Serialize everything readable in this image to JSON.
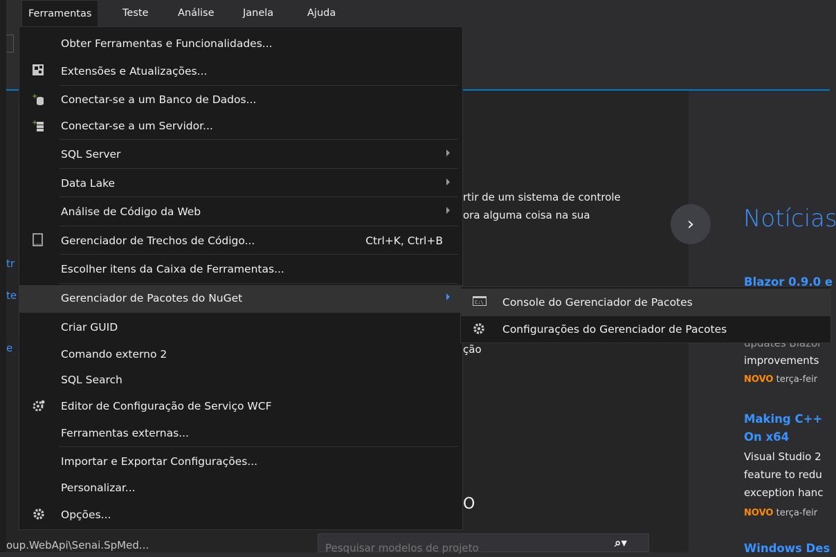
{
  "menubar": {
    "items": [
      "Ferramentas",
      "Teste",
      "Análise",
      "Janela",
      "Ajuda"
    ]
  },
  "tools_menu": {
    "items": [
      {
        "label": "Obter Ferramentas e Funcionalidades...",
        "icon": "none"
      },
      {
        "label": "Extensões e Atualizações...",
        "icon": "extensions-icon"
      },
      {
        "label": "Conectar-se a um Banco de Dados...",
        "icon": "database-connect-icon"
      },
      {
        "label": "Conectar-se a um Servidor...",
        "icon": "server-connect-icon"
      },
      {
        "label": "SQL Server",
        "submenu": true
      },
      {
        "label": "Data Lake",
        "submenu": true
      },
      {
        "label": "Análise de Código da Web",
        "submenu": true
      },
      {
        "label": "Gerenciador de Trechos de Código...",
        "shortcut": "Ctrl+K, Ctrl+B",
        "icon": "snippet-icon"
      },
      {
        "label": "Escolher itens da Caixa de Ferramentas..."
      },
      {
        "label": "Gerenciador de Pacotes do NuGet",
        "submenu": true,
        "highlighted": true
      },
      {
        "label": "Criar GUID"
      },
      {
        "label": "Comando externo 2"
      },
      {
        "label": "SQL Search"
      },
      {
        "label": "Editor de Configuração de Serviço WCF",
        "icon": "wcf-config-icon"
      },
      {
        "label": "Ferramentas externas..."
      },
      {
        "label": "Importar e Exportar Configurações..."
      },
      {
        "label": "Personalizar..."
      },
      {
        "label": "Opções...",
        "icon": "gear-icon"
      }
    ]
  },
  "nuget_submenu": {
    "items": [
      {
        "label": "Console do Gerenciador de Pacotes",
        "icon": "console-icon",
        "highlighted": true
      },
      {
        "label": "Configurações do Gerenciador de Pacotes",
        "icon": "gear-icon"
      }
    ]
  },
  "start_page": {
    "partial_line1": "rtir de um sistema de controle",
    "partial_line2": "ora alguma coisa na sua",
    "partial_line3": "ção",
    "partial_heading": "O",
    "left_edge_1": "tr",
    "left_edge_2": "te",
    "left_edge_3": "e"
  },
  "news": {
    "title": "Notícias",
    "item1_title": "Blazor 0.9.0 e",
    "item1_text_partial": "updates Blazor",
    "item1_text2": "improvements",
    "item1_badge": "NOVO",
    "item1_date": "terça-feir",
    "item2_title_1": "Making C++",
    "item2_title_2": "On x64",
    "item2_text1": "Visual Studio 2",
    "item2_text2": "feature to redu",
    "item2_text3": "exception hanc",
    "item2_badge": "NOVO",
    "item2_date": "terça-feir",
    "item3_title": "Windows Des"
  },
  "status": {
    "path": "oup.WebApi\\Senai.SpMed..."
  },
  "search": {
    "placeholder": "Pesquisar modelos de projeto"
  },
  "colors": {
    "accent": "#007acc",
    "link": "#3794ff",
    "badge": "#ff8c00",
    "menu_bg": "#1b1b1c"
  }
}
